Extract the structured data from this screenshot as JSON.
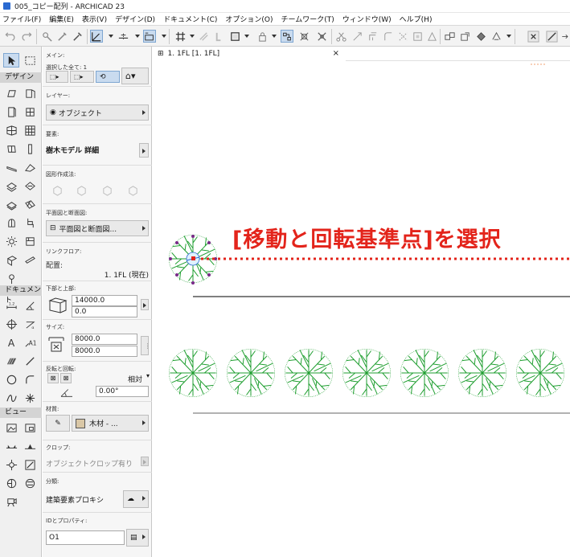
{
  "window": {
    "title": "005_コピー配列 - ARCHICAD 23"
  },
  "menu": [
    "ファイル(F)",
    "編集(E)",
    "表示(V)",
    "デザイン(D)",
    "ドキュメント(C)",
    "オプション(O)",
    "チームワーク(T)",
    "ウィンドウ(W)",
    "ヘルプ(H)"
  ],
  "toolbar_icons": [
    "undo-icon",
    "redo-icon",
    "pick-icon",
    "inject-icon",
    "eyedropper-icon",
    "snap-guides-icon",
    "snap-points-icon",
    "grid-snap-icon",
    "grid-icon",
    "hatch-icon",
    "wall-corner-icon",
    "trace-icon",
    "suspend-group-icon",
    "lock-icon",
    "show-hide-icon",
    "magic-wand-icon",
    "select-icon",
    "adjust-icon",
    "offset-icon",
    "explode-icon",
    "split-icon",
    "fillet-icon",
    "resize-icon",
    "mirror-icon",
    "rotate-icon",
    "elevate-icon",
    "multiply-icon",
    "align-icon",
    "pin-icon",
    "close-icon",
    "ruler-icon",
    "stretch-icon"
  ],
  "palette": {
    "sections": {
      "design": "デザイン",
      "document": "ドキュメント",
      "view": "ビュー"
    }
  },
  "infobox": {
    "main_label": "メイン:",
    "selection": "選択した全て: 1",
    "layer_label": "レイヤー:",
    "layer_value": "オブジェクト",
    "element_label": "要素:",
    "element_value": "樹木モデル 詳細",
    "geometry_label": "図形作成法:",
    "plan_label": "平面図と断面図:",
    "plan_value": "平面図と断面図...",
    "link_floor_label": "リンクフロア:",
    "placement_label": "配置:",
    "placement_value": "1. 1FL (現在)",
    "bottom_top_label": "下部と上部:",
    "top_value": "14000.0",
    "bottom_value": "0.0",
    "size_label": "サイズ:",
    "width_value": "8000.0",
    "depth_value": "8000.0",
    "mirror_label": "反転と回転:",
    "relative": "相対",
    "angle_value": "0.00°",
    "material_label": "材質:",
    "material_value": "木材 - ...",
    "crop_label": "クロップ:",
    "crop_value": "オブジェクトクロップ有り",
    "classify_label": "分類:",
    "classify_value": "建築要素プロキシ",
    "id_label": "IDとプロパティ:",
    "id_value": "O1"
  },
  "tab": {
    "label": "1. 1FL [1. 1FL]",
    "close": "×"
  },
  "annotation": "[移動と回転基準点]を選択",
  "colors": {
    "accent_red": "#e3241b",
    "tree_green": "#1e9e2f",
    "selection_blue": "#2a6ad1",
    "hotspot_purple": "#7a2a8a"
  }
}
